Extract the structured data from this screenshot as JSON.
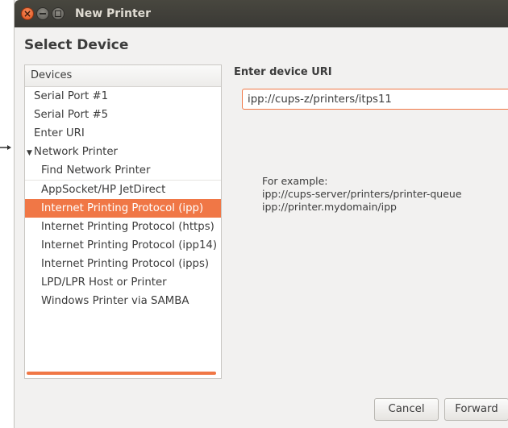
{
  "window": {
    "title": "New Printer"
  },
  "page": {
    "heading": "Select Device"
  },
  "devices": {
    "header": "Devices",
    "items": [
      {
        "label": "Serial Port #1"
      },
      {
        "label": "Serial Port #5"
      },
      {
        "label": "Enter URI"
      },
      {
        "label": "Network Printer",
        "expanded": true
      },
      {
        "label": "Find Network Printer"
      },
      {
        "label": "AppSocket/HP JetDirect"
      },
      {
        "label": "Internet Printing Protocol (ipp)",
        "selected": true
      },
      {
        "label": "Internet Printing Protocol (https)"
      },
      {
        "label": "Internet Printing Protocol (ipp14)"
      },
      {
        "label": "Internet Printing Protocol (ipps)"
      },
      {
        "label": "LPD/LPR Host or Printer"
      },
      {
        "label": "Windows Printer via SAMBA"
      }
    ],
    "expander_glyph": "▼"
  },
  "uri": {
    "label": "Enter device URI",
    "value": "ipp://cups-z/printers/itps11"
  },
  "example": {
    "line1": "For example:",
    "line2": "ipp://cups-server/printers/printer-queue",
    "line3": "ipp://printer.mydomain/ipp"
  },
  "buttons": {
    "cancel": "Cancel",
    "forward": "Forward"
  },
  "titlebar": {
    "close_glyph": "×"
  },
  "colors": {
    "accent": "#f07746",
    "titlebar": "#3c3b37",
    "window_bg": "#f2f1f0"
  }
}
